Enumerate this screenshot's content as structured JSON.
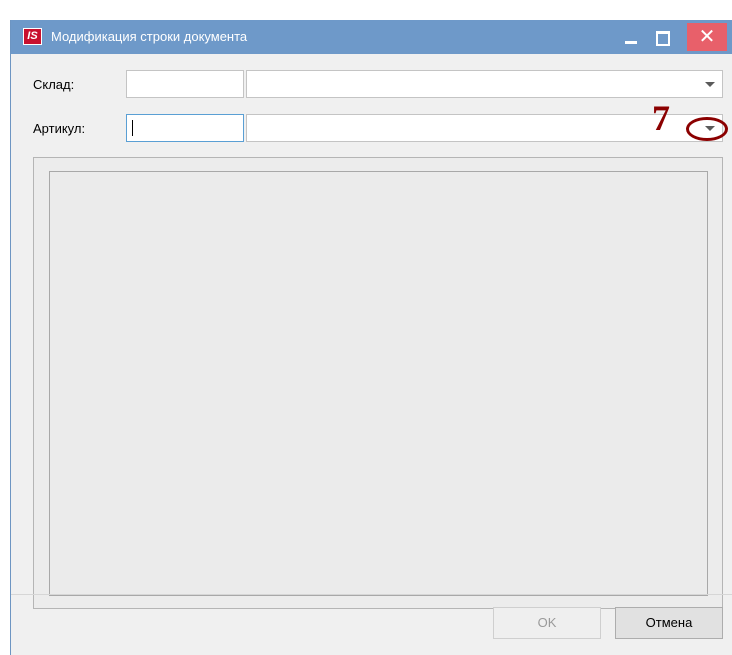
{
  "window": {
    "title": "Модификация строки документа",
    "logo_text": "IS",
    "close_glyph": "✕"
  },
  "form": {
    "sklad": {
      "label": "Склад:",
      "code_value": "",
      "name_value": ""
    },
    "artikul": {
      "label": "Артикул:",
      "code_value": "",
      "name_value": ""
    }
  },
  "annotation": {
    "number": "7"
  },
  "buttons": {
    "ok_label": "OK",
    "cancel_label": "Отмена"
  },
  "colors": {
    "titlebar": "#6e99c9",
    "close_button": "#e8606a",
    "logo": "#c8102e",
    "annotation": "#8b0000"
  },
  "icons": [
    "is-logo-icon",
    "minimize-icon",
    "maximize-icon",
    "close-icon",
    "dropdown-arrow-icon"
  ]
}
